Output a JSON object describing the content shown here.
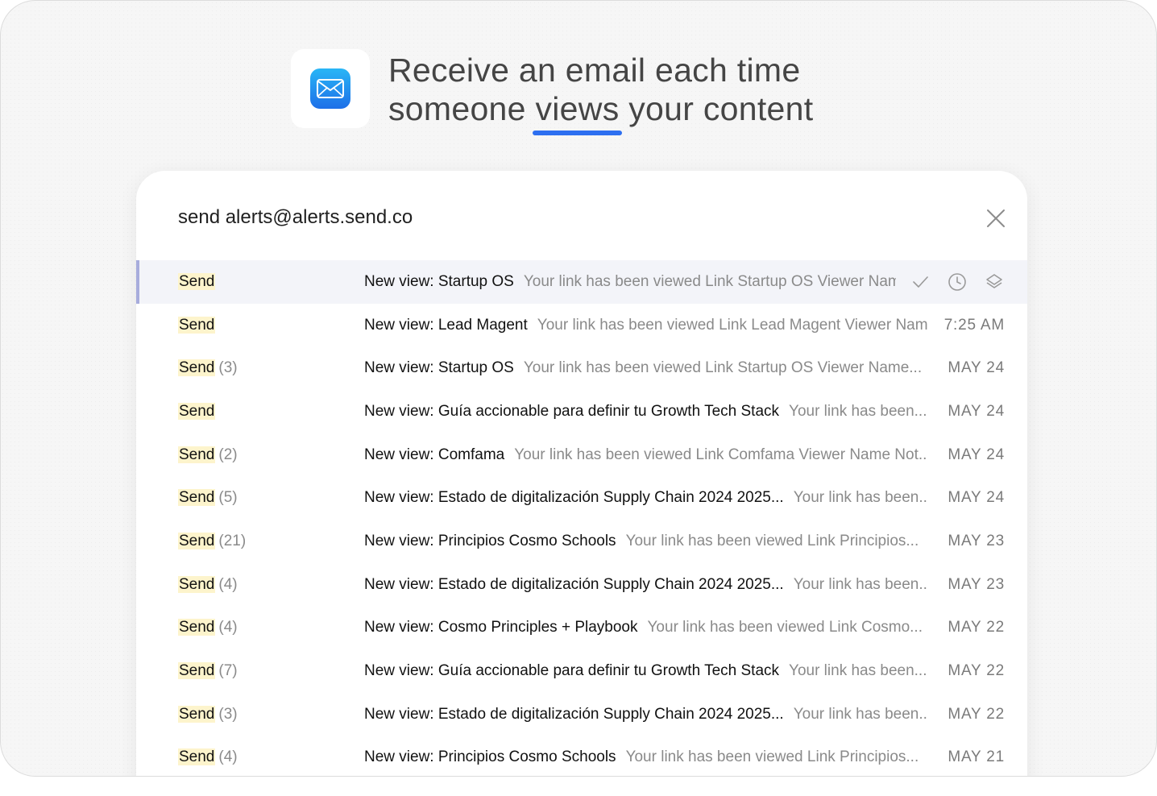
{
  "headline": {
    "line1": "Receive an email each time",
    "line2_before": "someone",
    "line2_highlight": "views",
    "line2_after": "your content"
  },
  "panel": {
    "title": "send alerts@alerts.send.co",
    "close_icon": "close-icon"
  },
  "icons": {
    "app": "mail-icon",
    "row_actions": [
      "check-icon",
      "clock-icon",
      "layers-icon"
    ]
  },
  "colors": {
    "accent": "#2d6ff0",
    "sender_highlight": "#fdf4cc",
    "active_row_bg": "#f3f4f9",
    "active_row_marker": "#a7acdc"
  },
  "emails": [
    {
      "sender": "Send",
      "count": "",
      "subject": "New view: Startup OS",
      "preview": "Your link has been viewed Link Startup OS Viewer Name...",
      "date": ""
    },
    {
      "sender": "Send",
      "count": "",
      "subject": "New view: Lead Magent",
      "preview": "Your link has been viewed Link Lead Magent Viewer Name...",
      "date": "7:25 AM"
    },
    {
      "sender": "Send",
      "count": "(3)",
      "subject": "New view: Startup OS",
      "preview": "Your link has been viewed Link Startup OS Viewer Name...",
      "date": "MAY 24"
    },
    {
      "sender": "Send",
      "count": "",
      "subject": "New view: Guía accionable para definir tu Growth Tech Stack",
      "preview": "Your link has been...",
      "date": "MAY 24"
    },
    {
      "sender": "Send",
      "count": "(2)",
      "subject": "New view: Comfama",
      "preview": "Your link has been viewed Link Comfama Viewer Name Not...",
      "date": "MAY 24"
    },
    {
      "sender": "Send",
      "count": "(5)",
      "subject": "New view: Estado de digitalización Supply Chain 2024 2025...",
      "preview": "Your link has been...",
      "date": "MAY 24"
    },
    {
      "sender": "Send",
      "count": "(21)",
      "subject": "New view: Principios Cosmo Schools",
      "preview": "Your link has been viewed Link Principios...",
      "date": "MAY 23"
    },
    {
      "sender": "Send",
      "count": "(4)",
      "subject": "New view: Estado de digitalización Supply Chain 2024 2025...",
      "preview": "Your link has been...",
      "date": "MAY 23"
    },
    {
      "sender": "Send",
      "count": "(4)",
      "subject": "New view: Cosmo Principles + Playbook",
      "preview": "Your link has been viewed Link Cosmo...",
      "date": "MAY 22"
    },
    {
      "sender": "Send",
      "count": "(7)",
      "subject": "New view: Guía accionable para definir tu Growth Tech Stack",
      "preview": "Your link has been...",
      "date": "MAY 22"
    },
    {
      "sender": "Send",
      "count": "(3)",
      "subject": "New view: Estado de digitalización Supply Chain 2024 2025...",
      "preview": "Your link has been...",
      "date": "MAY 22"
    },
    {
      "sender": "Send",
      "count": "(4)",
      "subject": "New view: Principios Cosmo Schools",
      "preview": "Your link has been viewed Link Principios...",
      "date": "MAY 21"
    }
  ]
}
